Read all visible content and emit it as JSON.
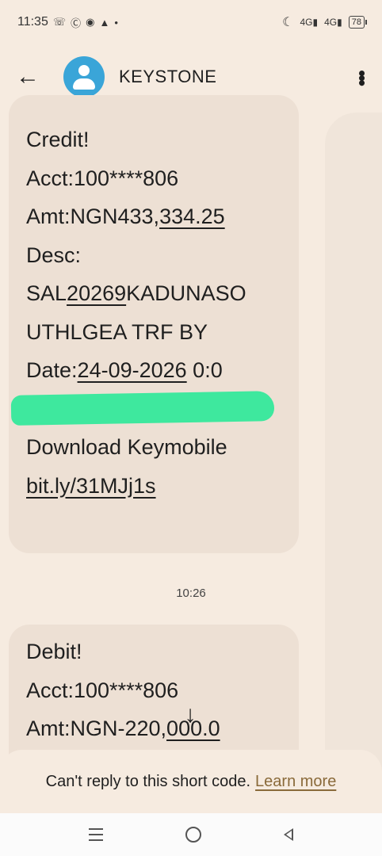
{
  "status": {
    "time": "11:35",
    "notif_icons": [
      "whatsapp-icon",
      "facebook-icon",
      "chat-icon",
      "warning-icon",
      "dot-icon"
    ],
    "signal_1": "4G",
    "signal_2": "4G",
    "battery": "78"
  },
  "header": {
    "contact_name": "KEYSTONE"
  },
  "messages": [
    {
      "lines": [
        "Credit!",
        "Acct:100****806",
        "Amt:NGN433,334.25",
        "Desc:",
        "SAL20269KADUNASO",
        "UTHLGEA  TRF BY",
        "Date:24-09-2026 0:0",
        "",
        "Download Keymobile",
        "bit.ly/31MJj1s"
      ]
    },
    {
      "lines": [
        "Debit!",
        "Acct:100****806",
        "Amt:NGN-220,000.0"
      ]
    }
  ],
  "timestamp": "10:26",
  "reply_bar": {
    "text": "Can't reply to this short code.",
    "link": "Learn more"
  }
}
